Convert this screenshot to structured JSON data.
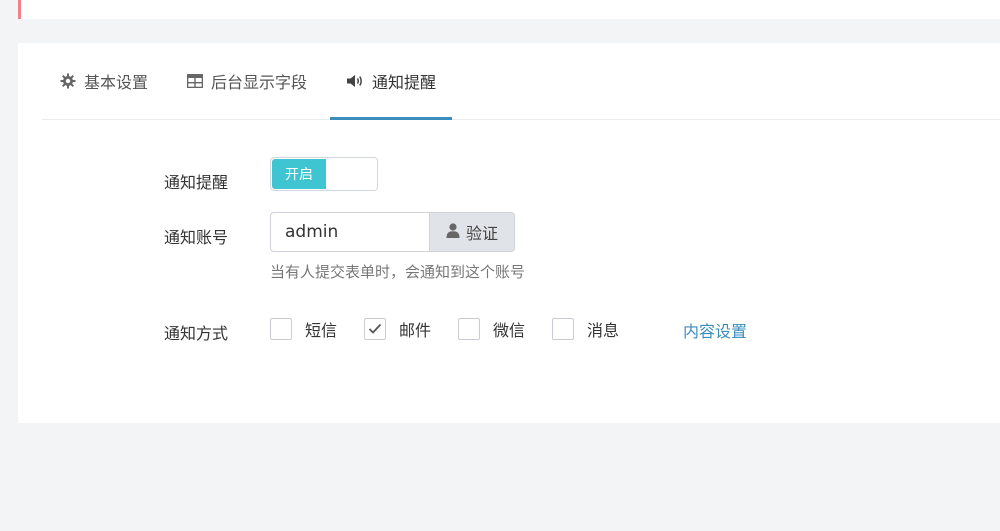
{
  "tabs": [
    {
      "label": "基本设置",
      "icon": "gear-icon"
    },
    {
      "label": "后台显示字段",
      "icon": "table-icon"
    },
    {
      "label": "通知提醒",
      "icon": "volume-icon",
      "active": true
    }
  ],
  "notify": {
    "label": "通知提醒",
    "switch_label": "开启",
    "enabled": true
  },
  "account": {
    "label": "通知账号",
    "value": "admin",
    "verify_label": "验证",
    "verify_icon": "user-icon",
    "hint": "当有人提交表单时，会通知到这个账号"
  },
  "method": {
    "label": "通知方式",
    "options": [
      {
        "label": "短信",
        "checked": false
      },
      {
        "label": "邮件",
        "checked": true
      },
      {
        "label": "微信",
        "checked": false
      },
      {
        "label": "消息",
        "checked": false
      }
    ],
    "content_link": "内容设置"
  },
  "colors": {
    "accent": "#3c8dbc",
    "switch_on": "#3fc4d1",
    "top_accent": "#f0808a"
  }
}
